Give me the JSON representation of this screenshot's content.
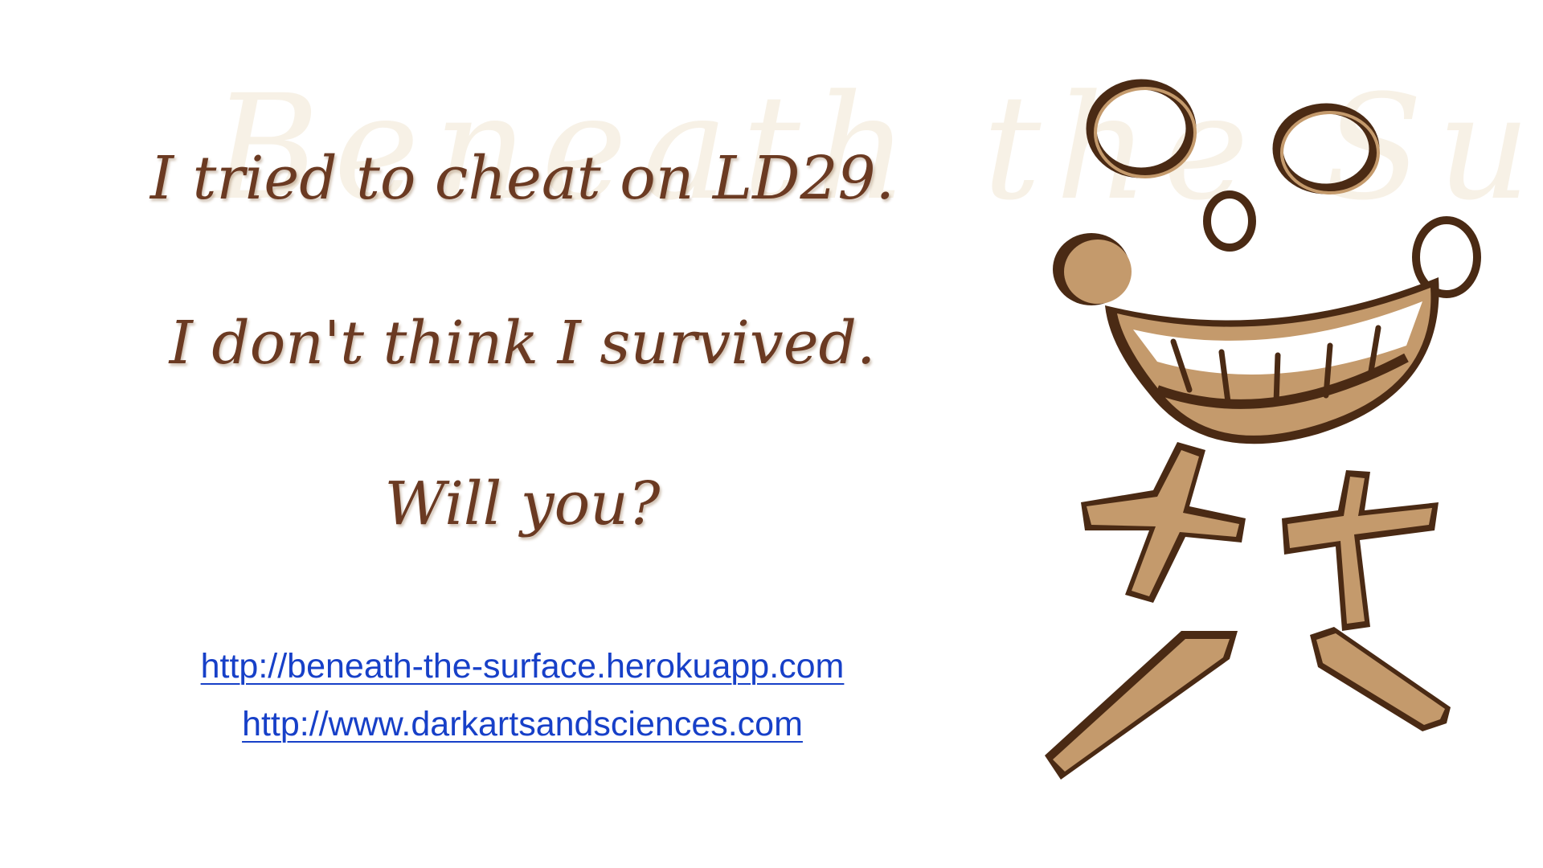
{
  "watermark": {
    "text": "Beneath the Surface"
  },
  "message": {
    "line1": "I tried to cheat on LD29.",
    "line2": "I don't think I survived.",
    "line3": "Will you?"
  },
  "links": [
    {
      "text": "http://beneath-the-surface.herokuapp.com"
    },
    {
      "text": "http://www.darkartsandsciences.com"
    }
  ],
  "colors": {
    "text_brown": "#6b3a22",
    "link_blue": "#1740c8",
    "cardboard": "#c49a6c",
    "outline": "#4a2a14"
  },
  "illustration": {
    "icon": "grinning-skull-face-icon"
  }
}
